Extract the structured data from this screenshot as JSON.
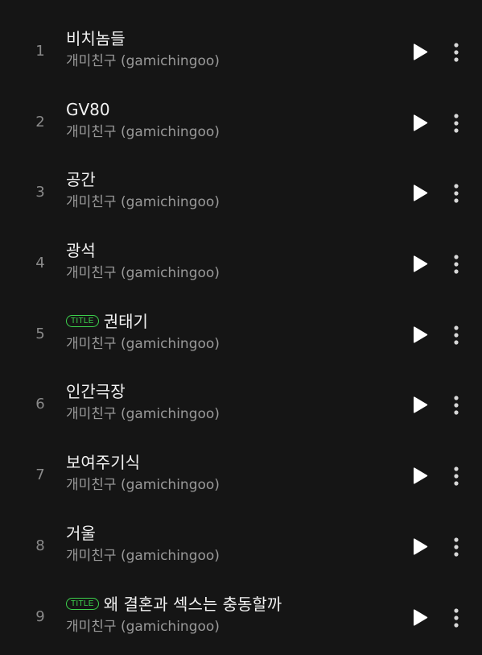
{
  "tracks": [
    {
      "number": "1",
      "title": "비치놈들",
      "badge": "",
      "artist": "개미친구 (gamichingoo)"
    },
    {
      "number": "2",
      "title": "GV80",
      "badge": "",
      "artist": "개미친구 (gamichingoo)"
    },
    {
      "number": "3",
      "title": "공간",
      "badge": "",
      "artist": "개미친구 (gamichingoo)"
    },
    {
      "number": "4",
      "title": "광석",
      "badge": "",
      "artist": "개미친구 (gamichingoo)"
    },
    {
      "number": "5",
      "title": "권태기",
      "badge": "TITLE",
      "artist": "개미친구 (gamichingoo)"
    },
    {
      "number": "6",
      "title": "인간극장",
      "badge": "",
      "artist": "개미친구 (gamichingoo)"
    },
    {
      "number": "7",
      "title": "보여주기식",
      "badge": "",
      "artist": "개미친구 (gamichingoo)"
    },
    {
      "number": "8",
      "title": "거울",
      "badge": "",
      "artist": "개미친구 (gamichingoo)"
    },
    {
      "number": "9",
      "title": "왜 결혼과 섹스는 충동할까",
      "badge": "TITLE",
      "artist": "개미친구 (gamichingoo)"
    }
  ],
  "icons": {
    "play": "play-icon",
    "more": "more-vertical-icon"
  },
  "colors": {
    "background": "#151515",
    "title_text": "#f2f2f2",
    "artist_text": "#9a9a9a",
    "number_text": "#8a8a8a",
    "badge_accent": "#3dd34d",
    "icon": "#ffffff"
  }
}
